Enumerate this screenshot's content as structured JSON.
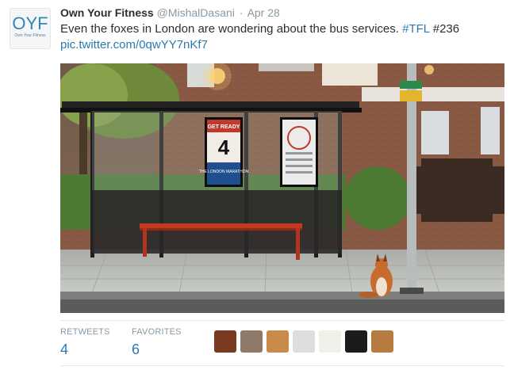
{
  "tweet": {
    "author_name": "Own Your Fitness",
    "handle": "@MishalDasani",
    "separator": "·",
    "date": "Apr 28",
    "text": "Even the foxes in London are wondering about the bus services.",
    "hashtag": "#TFL",
    "route": "#236",
    "pic_link": "pic.twitter.com/0qwYY7nKf7"
  },
  "avatar": {
    "logo_text": "OYF",
    "logo_subtext": "Own Your Fitness"
  },
  "photo": {
    "poster_top": "GET READY",
    "poster_number": "4",
    "poster_bottom": "THE LONDON MARATHON"
  },
  "stats": {
    "retweets_label": "RETWEETS",
    "retweets_count": "4",
    "favorites_label": "FAVORITES",
    "favorites_count": "6"
  },
  "favoriters": [
    {
      "name": "favoriter-1"
    },
    {
      "name": "favoriter-2"
    },
    {
      "name": "favoriter-3"
    },
    {
      "name": "favoriter-4"
    },
    {
      "name": "favoriter-5"
    },
    {
      "name": "favoriter-6"
    },
    {
      "name": "favoriter-7"
    }
  ],
  "colors": {
    "link": "#2a7ab0",
    "muted": "#8899a6",
    "text": "#292f33"
  }
}
